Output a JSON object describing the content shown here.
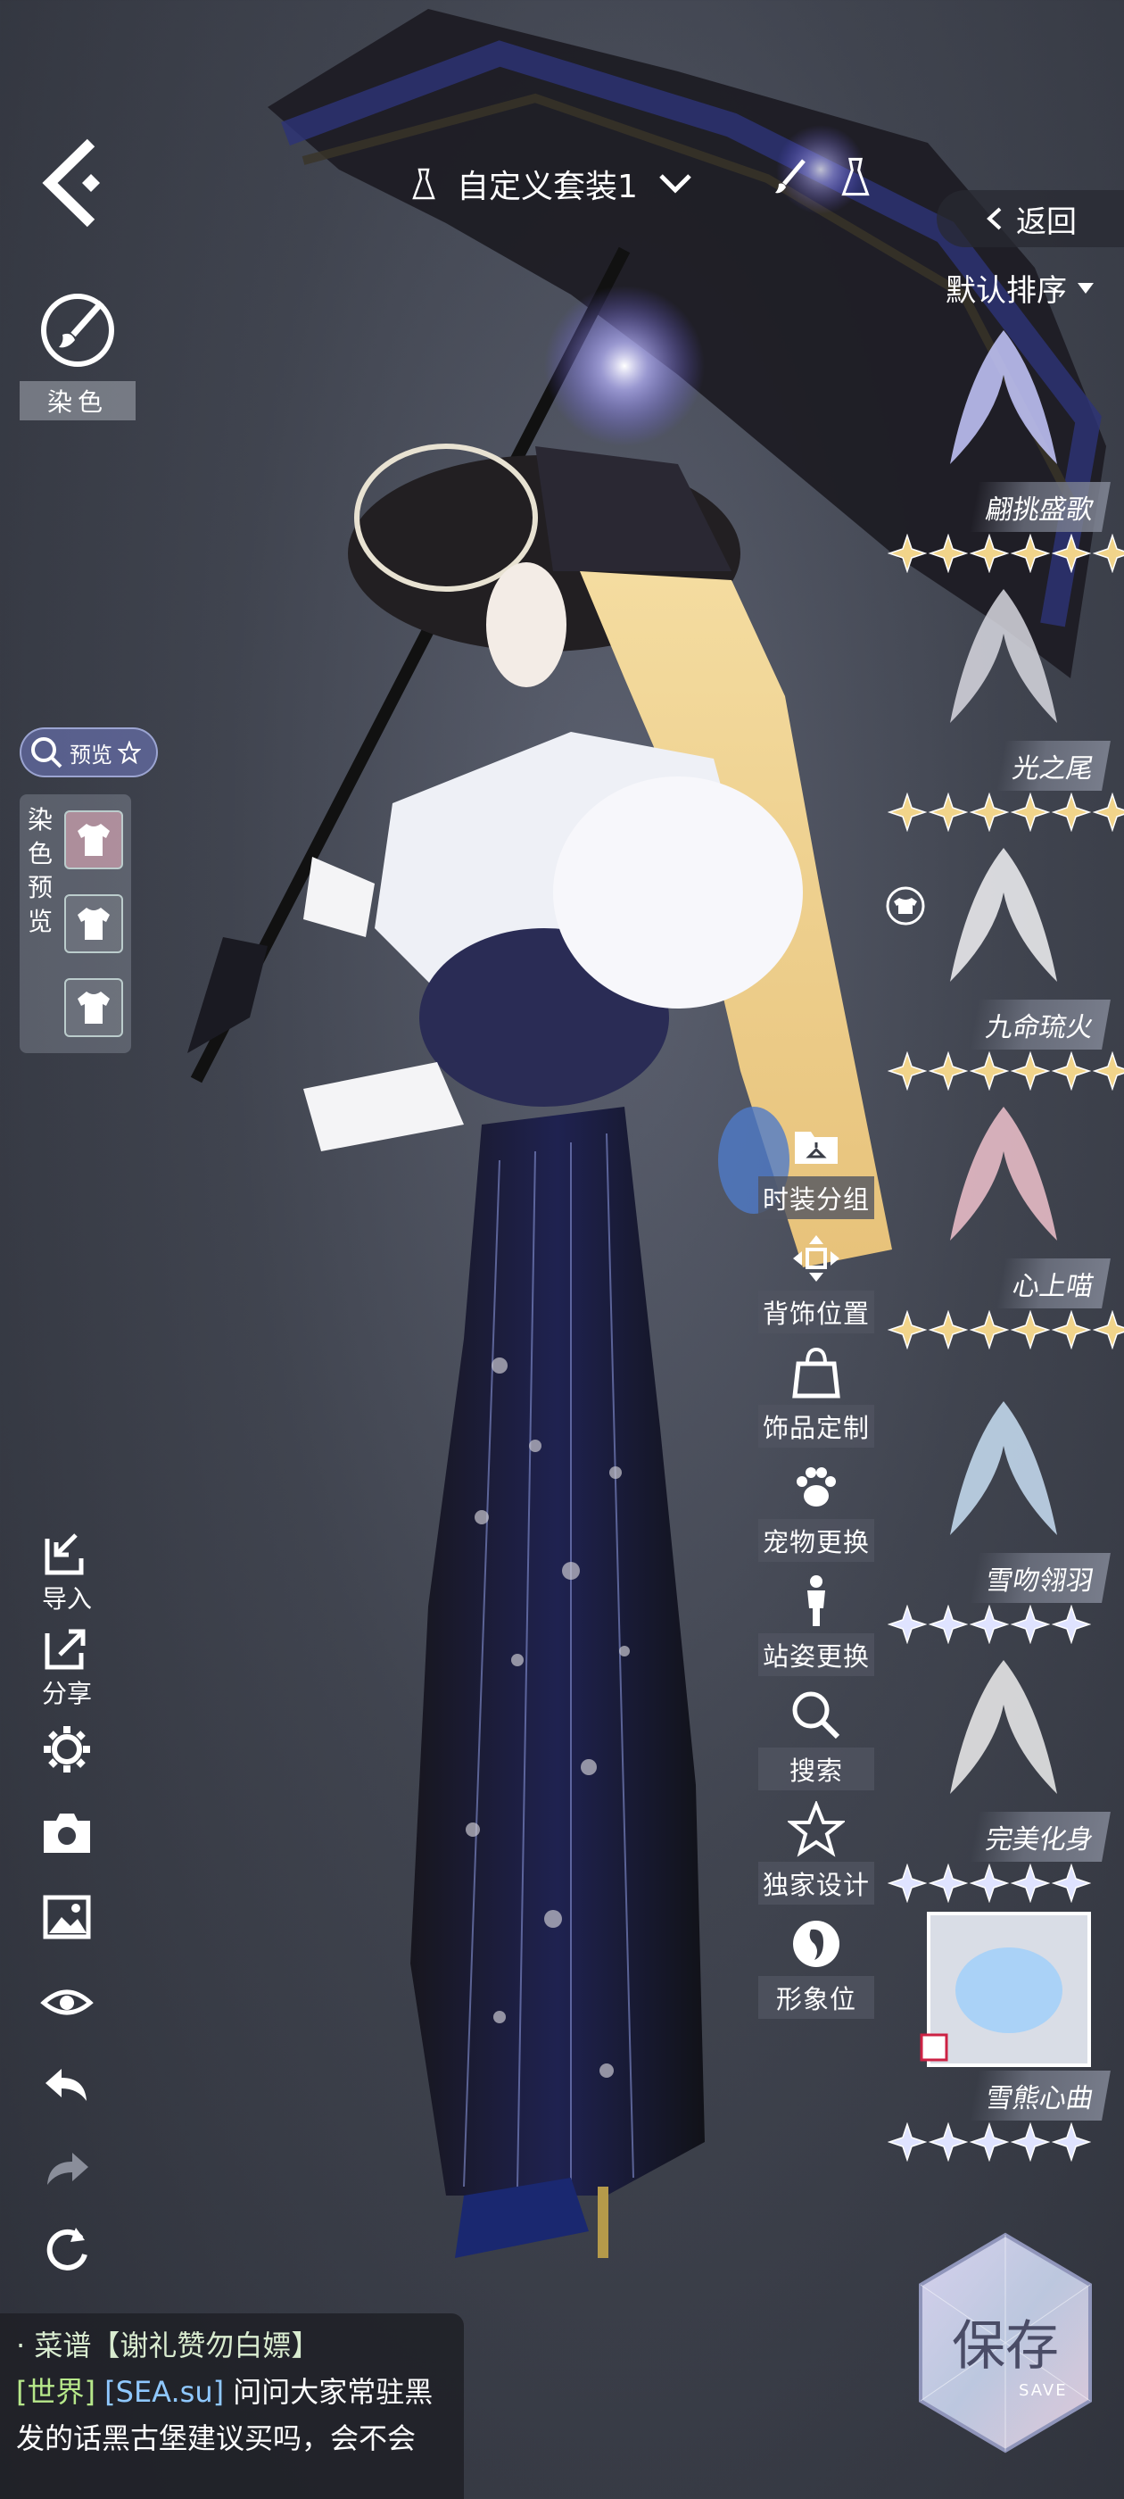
{
  "topbar": {
    "outfit_name": "自定义套装1",
    "return_label": "返回",
    "sort_label": "默认排序"
  },
  "left_tools": {
    "dye_label": "染色",
    "preview_label": "预览",
    "dye_preview_label": "染色预览",
    "import_label": "导入",
    "share_label": "分享"
  },
  "functions": [
    {
      "label": "时装分组",
      "icon": "hanger-folder-icon"
    },
    {
      "label": "背饰位置",
      "icon": "move-arrows-icon"
    },
    {
      "label": "饰品定制",
      "icon": "bag-icon"
    },
    {
      "label": "宠物更换",
      "icon": "paw-icon"
    },
    {
      "label": "站姿更换",
      "icon": "person-icon"
    },
    {
      "label": "搜索",
      "icon": "search-icon"
    },
    {
      "label": "独家设计",
      "icon": "star-icon"
    },
    {
      "label": "形象位",
      "icon": "portrait-icon"
    }
  ],
  "items": [
    {
      "name": "翩挑盛歌",
      "stars": 6,
      "color": "#c7c9ff"
    },
    {
      "name": "光之尾",
      "stars": 6,
      "color": "#d8d8e0"
    },
    {
      "name": "九命琉火",
      "stars": 6,
      "color": "#f2f2f5"
    },
    {
      "name": "心上喵",
      "stars": 6,
      "color": "#f0c2cc"
    },
    {
      "name": "雪吻翎羽",
      "stars": 5,
      "color": "#c9dff5"
    },
    {
      "name": "完美化身",
      "stars": 5,
      "color": "#eeeeee"
    },
    {
      "name": "雪熊心曲",
      "stars": 5,
      "color": "#aad2f7"
    }
  ],
  "save": {
    "label": "保存",
    "sub": "SAVE"
  },
  "chat": {
    "line1": "· 菜谱【谢礼赞勿白嫖】",
    "channel": "[世界]",
    "user": "[SEA.su]",
    "message": "问问大家常驻黑发的话黑古堡建议买吗，会不会"
  },
  "colors": {
    "gold_star": "#f1d48a",
    "silver_star": "#dfe3ff",
    "panel": "#2d3039"
  }
}
